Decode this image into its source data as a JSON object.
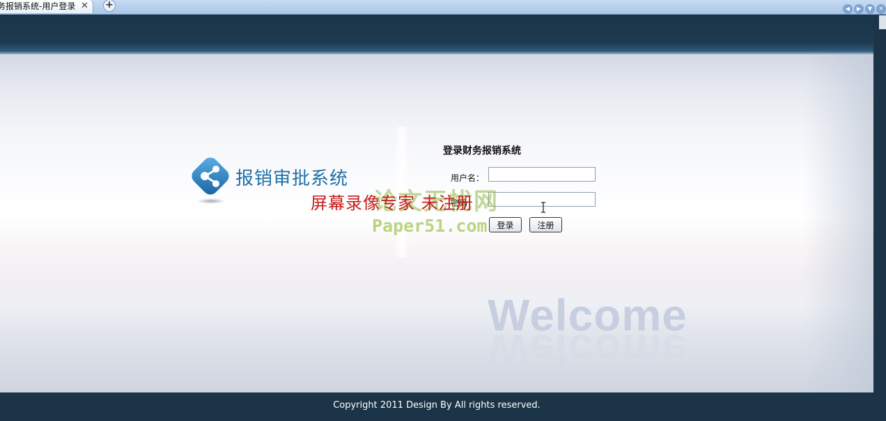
{
  "browser": {
    "tab_title": "务报销系统-用户登录",
    "close_glyph": "✕",
    "newtab_glyph": "+",
    "nav_glyphs": [
      "◀",
      "▶",
      "▼",
      "✕"
    ]
  },
  "logo": {
    "text": "报销审批系统",
    "icon": "share-network-icon"
  },
  "login": {
    "title": "登录财务报销系统",
    "username_label": "用户名：",
    "password_label": "密码：",
    "username_value": "",
    "password_value": "",
    "login_button": "登录",
    "register_button": "注册"
  },
  "watermarks": {
    "recorder": "屏幕录像专家 未注册",
    "site_name": "论文无忧网",
    "site_url": "Paper51.com"
  },
  "welcome_text": "Welcome",
  "footer": {
    "copyright": "Copyright 2011 Design By All rights reserved."
  },
  "colors": {
    "header_bg": "#1b3447",
    "logo_blue": "#1f6fa8",
    "watermark_red": "#c61b1b"
  }
}
